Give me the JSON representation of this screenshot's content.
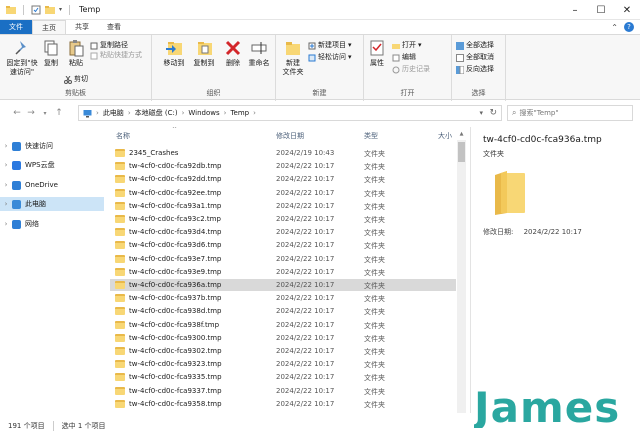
{
  "window": {
    "title": "Temp"
  },
  "tabs": [
    {
      "label": "文件"
    },
    {
      "label": "主页"
    },
    {
      "label": "共享"
    },
    {
      "label": "查看"
    }
  ],
  "ribbon": {
    "clipboard": {
      "label": "剪贴板",
      "pin": "固定到\"快\n速访问\"",
      "copy": "复制",
      "paste": "粘贴",
      "copy_path": "复制路径",
      "paste_shortcut": "粘贴快捷方式",
      "cut": "剪切"
    },
    "organize": {
      "label": "组织",
      "move_to": "移动到",
      "copy_to": "复制到",
      "delete": "删除",
      "rename": "重命名"
    },
    "new": {
      "label": "新建",
      "new_folder": "新建\n文件夹",
      "new_item": "新建项目",
      "easy_access": "轻松访问"
    },
    "open": {
      "label": "打开",
      "properties": "属性",
      "open": "打开",
      "edit": "编辑",
      "history": "历史记录"
    },
    "select": {
      "label": "选择",
      "select_all": "全部选择",
      "select_none": "全部取消",
      "invert": "反向选择"
    }
  },
  "address": {
    "crumbs": [
      "此电脑",
      "本地磁盘 (C:)",
      "Windows",
      "Temp"
    ],
    "search_placeholder": "搜索\"Temp\""
  },
  "nav": [
    {
      "label": "快速访问",
      "color": "#2f7fd6"
    },
    {
      "label": "WPS云盘",
      "color": "#2b79e0"
    },
    {
      "label": "OneDrive",
      "color": "#2f7fd6"
    },
    {
      "label": "此电脑",
      "color": "#3a8ad8"
    },
    {
      "label": "网络",
      "color": "#2f7fd6"
    }
  ],
  "columns": {
    "name": "名称",
    "date": "修改日期",
    "type": "类型",
    "size": "大小"
  },
  "files": [
    {
      "name": "2345_Crashes",
      "date": "2024/2/19 10:43",
      "type": "文件夹"
    },
    {
      "name": "tw-4cf0-cd0c-fca92db.tmp",
      "date": "2024/2/22 10:17",
      "type": "文件夹"
    },
    {
      "name": "tw-4cf0-cd0c-fca92dd.tmp",
      "date": "2024/2/22 10:17",
      "type": "文件夹"
    },
    {
      "name": "tw-4cf0-cd0c-fca92ee.tmp",
      "date": "2024/2/22 10:17",
      "type": "文件夹"
    },
    {
      "name": "tw-4cf0-cd0c-fca93a1.tmp",
      "date": "2024/2/22 10:17",
      "type": "文件夹"
    },
    {
      "name": "tw-4cf0-cd0c-fca93c2.tmp",
      "date": "2024/2/22 10:17",
      "type": "文件夹"
    },
    {
      "name": "tw-4cf0-cd0c-fca93d4.tmp",
      "date": "2024/2/22 10:17",
      "type": "文件夹"
    },
    {
      "name": "tw-4cf0-cd0c-fca93d6.tmp",
      "date": "2024/2/22 10:17",
      "type": "文件夹"
    },
    {
      "name": "tw-4cf0-cd0c-fca93e7.tmp",
      "date": "2024/2/22 10:17",
      "type": "文件夹"
    },
    {
      "name": "tw-4cf0-cd0c-fca93e9.tmp",
      "date": "2024/2/22 10:17",
      "type": "文件夹"
    },
    {
      "name": "tw-4cf0-cd0c-fca936a.tmp",
      "date": "2024/2/22 10:17",
      "type": "文件夹"
    },
    {
      "name": "tw-4cf0-cd0c-fca937b.tmp",
      "date": "2024/2/22 10:17",
      "type": "文件夹"
    },
    {
      "name": "tw-4cf0-cd0c-fca938d.tmp",
      "date": "2024/2/22 10:17",
      "type": "文件夹"
    },
    {
      "name": "tw-4cf0-cd0c-fca938f.tmp",
      "date": "2024/2/22 10:17",
      "type": "文件夹"
    },
    {
      "name": "tw-4cf0-cd0c-fca9300.tmp",
      "date": "2024/2/22 10:17",
      "type": "文件夹"
    },
    {
      "name": "tw-4cf0-cd0c-fca9302.tmp",
      "date": "2024/2/22 10:17",
      "type": "文件夹"
    },
    {
      "name": "tw-4cf0-cd0c-fca9323.tmp",
      "date": "2024/2/22 10:17",
      "type": "文件夹"
    },
    {
      "name": "tw-4cf0-cd0c-fca9335.tmp",
      "date": "2024/2/22 10:17",
      "type": "文件夹"
    },
    {
      "name": "tw-4cf0-cd0c-fca9337.tmp",
      "date": "2024/2/22 10:17",
      "type": "文件夹"
    },
    {
      "name": "tw-4cf0-cd0c-fca9358.tmp",
      "date": "2024/2/22 10:17",
      "type": "文件夹"
    }
  ],
  "selected_file": 10,
  "details": {
    "name": "tw-4cf0-cd0c-fca936a.tmp",
    "type": "文件夹",
    "modified_label": "修改日期:",
    "modified_value": "2024/2/22 10:17"
  },
  "status": {
    "count": "191 个项目",
    "selected": "选中 1 个项目"
  },
  "watermark": "James",
  "colors": {
    "accent": "#1a6fc4",
    "folder": "#f8d775",
    "selection": "#d9d9d9",
    "nav_selection": "#cce4f7",
    "watermark": "#2aa7a0"
  }
}
